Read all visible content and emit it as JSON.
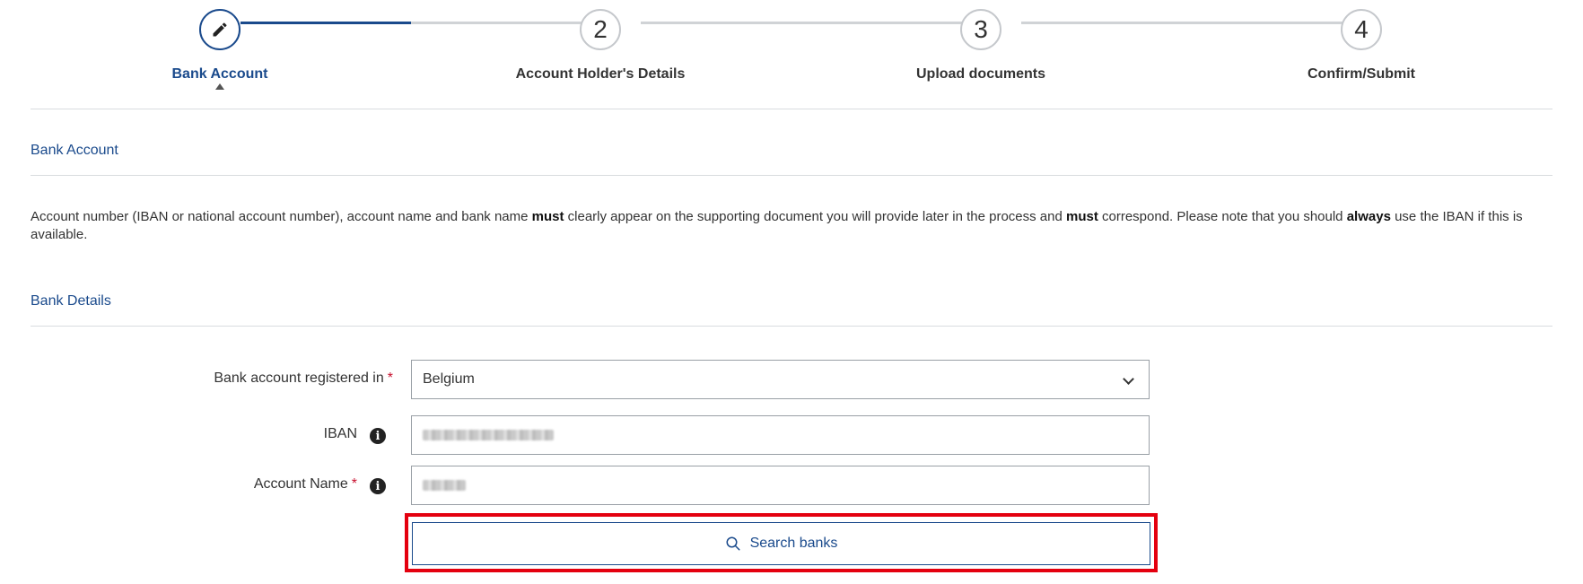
{
  "stepper": {
    "steps": [
      {
        "label": "Bank Account",
        "number": "",
        "icon": "pencil-icon",
        "state": "current"
      },
      {
        "label": "Account Holder's Details",
        "number": "2",
        "state": "upcoming"
      },
      {
        "label": "Upload documents",
        "number": "3",
        "state": "upcoming"
      },
      {
        "label": "Confirm/Submit",
        "number": "4",
        "state": "upcoming"
      }
    ]
  },
  "sections": {
    "bank_account_title": "Bank Account",
    "bank_details_title": "Bank Details"
  },
  "notice": {
    "t1": "Account number (IBAN or national account number), account name and bank name ",
    "b1": "must",
    "t2": " clearly appear on the supporting document you will provide later in the process and ",
    "b2": "must",
    "t3": " correspond. Please note that you should ",
    "b3": "always",
    "t4": " use the IBAN if this is available."
  },
  "form": {
    "country": {
      "label": "Bank account registered in",
      "required_mark": "*",
      "value": "Belgium"
    },
    "iban": {
      "label": "IBAN",
      "value_redacted": true
    },
    "account_name": {
      "label": "Account Name",
      "required_mark": "*",
      "value_redacted": true
    },
    "search_button_label": "Search banks"
  },
  "colors": {
    "primary": "#1a4a8c",
    "required": "#c8102e",
    "highlight": "#e4000f"
  }
}
